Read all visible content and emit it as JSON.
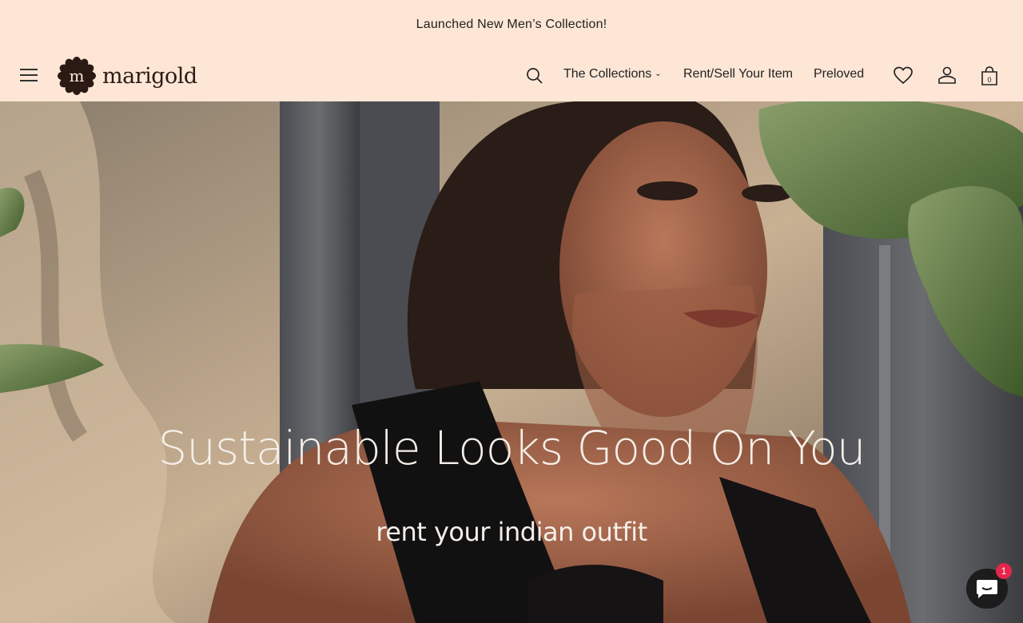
{
  "announcement": {
    "text": "Launched New Men’s Collection!"
  },
  "brand": {
    "name": "marigold",
    "monogram": "m",
    "logo_color": "#2b1a14"
  },
  "header": {
    "menu_icon": "hamburger-icon",
    "search_icon": "search-icon",
    "nav": [
      {
        "label": "The Collections",
        "has_dropdown": true
      },
      {
        "label": "Rent/Sell Your Item"
      },
      {
        "label": "Preloved"
      }
    ],
    "icons": [
      "heart-icon",
      "account-icon",
      "shopping-bag-icon"
    ],
    "cart_count": "0"
  },
  "hero": {
    "title": "Sustainable Looks Good On You",
    "subtitle": "rent your indian outfit"
  },
  "chat": {
    "icon": "chat-icon",
    "badge": "1"
  },
  "colors": {
    "background": "#fde6d5",
    "text": "#222222",
    "badge": "#e5254b",
    "hero_text": "#f5efe8"
  }
}
